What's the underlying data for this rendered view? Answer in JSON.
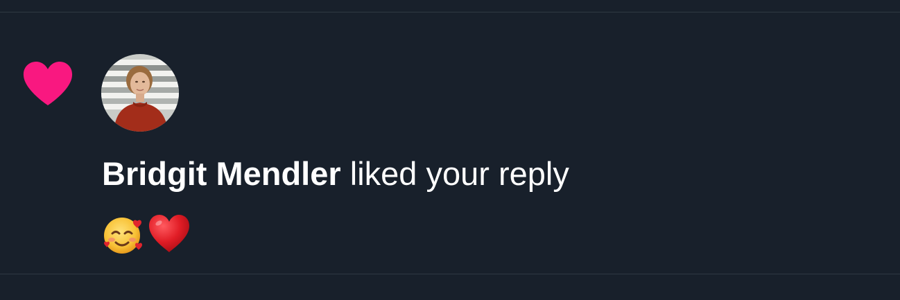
{
  "notification": {
    "type_icon": "heart-icon",
    "avatar_icon": "user-avatar",
    "actor_name": "Bridgit Mendler",
    "action_text": " liked your reply",
    "reply_content": {
      "emojis": [
        "smiling-face-with-hearts-emoji",
        "red-heart-emoji"
      ]
    }
  },
  "colors": {
    "background": "#18202b",
    "divider": "#2f3943",
    "like_pink": "#f91880",
    "text": "#ffffff"
  }
}
